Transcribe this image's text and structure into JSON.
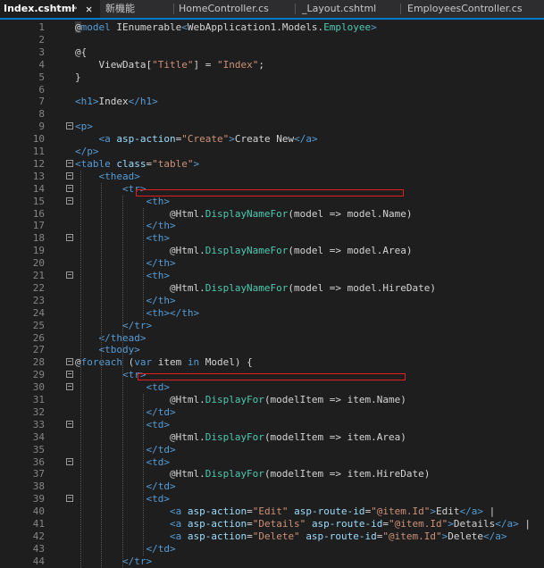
{
  "tabs": [
    {
      "label": "Index.cshtml",
      "active": true
    },
    {
      "label": "新機能",
      "active": false
    },
    {
      "label": "HomeController.cs",
      "active": false
    },
    {
      "label": "_Layout.cshtml",
      "active": false
    },
    {
      "label": "EmployeesController.cs",
      "active": false
    }
  ],
  "tab_icons": {
    "pin": "pin-icon",
    "close": "close-icon"
  },
  "tab_glyphs": {
    "pin": "⊸",
    "close": "✕"
  },
  "colors": {
    "background": "#1e1e1e",
    "tag": "#569cd6",
    "attribute": "#9cdcfe",
    "string": "#ce9178",
    "type": "#4ec9b0",
    "text": "#d4d4d4",
    "line_number": "#858585",
    "highlight_box": "#e02020"
  },
  "lines": [
    {
      "n": "1",
      "tokens": [
        [
          "at",
          "@"
        ],
        [
          "kw",
          "model "
        ],
        [
          "text",
          "IEnumerable"
        ],
        [
          "tag",
          "<"
        ],
        [
          "text",
          "WebApplication1.Models."
        ],
        [
          "type",
          "Employee"
        ],
        [
          "tag",
          ">"
        ]
      ]
    },
    {
      "n": "2",
      "tokens": []
    },
    {
      "n": "3",
      "tokens": [
        [
          "text",
          "@{"
        ]
      ]
    },
    {
      "n": "4",
      "tokens": [
        [
          "text",
          "    ViewData["
        ],
        [
          "str",
          "\"Title\""
        ],
        [
          "text",
          "] = "
        ],
        [
          "str",
          "\"Index\""
        ],
        [
          "text",
          ";"
        ]
      ]
    },
    {
      "n": "5",
      "tokens": [
        [
          "text",
          "}"
        ]
      ]
    },
    {
      "n": "6",
      "tokens": []
    },
    {
      "n": "7",
      "tokens": [
        [
          "tag",
          "<h1>"
        ],
        [
          "text",
          "Index"
        ],
        [
          "tag",
          "</h1>"
        ]
      ]
    },
    {
      "n": "8",
      "tokens": []
    },
    {
      "n": "9",
      "tokens": [
        [
          "tag",
          "<p>"
        ]
      ]
    },
    {
      "n": "10",
      "tokens": [
        [
          "text",
          "    "
        ],
        [
          "tag",
          "<a "
        ],
        [
          "attr",
          "asp-action"
        ],
        [
          "text",
          "="
        ],
        [
          "str",
          "\"Create\""
        ],
        [
          "tag",
          ">"
        ],
        [
          "text",
          "Create New"
        ],
        [
          "tag",
          "</a>"
        ]
      ]
    },
    {
      "n": "11",
      "tokens": [
        [
          "tag",
          "</p>"
        ]
      ]
    },
    {
      "n": "12",
      "tokens": [
        [
          "tag",
          "<table "
        ],
        [
          "attr",
          "class"
        ],
        [
          "text",
          "="
        ],
        [
          "str",
          "\"table\""
        ],
        [
          "tag",
          ">"
        ]
      ]
    },
    {
      "n": "13",
      "tokens": [
        [
          "text",
          "    "
        ],
        [
          "tag",
          "<thead>"
        ]
      ]
    },
    {
      "n": "14",
      "tokens": [
        [
          "text",
          "        "
        ],
        [
          "tag",
          "<tr>"
        ]
      ]
    },
    {
      "n": "15",
      "tokens": [
        [
          "text",
          "            "
        ],
        [
          "tag",
          "<th>"
        ]
      ]
    },
    {
      "n": "16",
      "tokens": [
        [
          "text",
          "                @Html."
        ],
        [
          "type",
          "DisplayNameFor"
        ],
        [
          "text",
          "(model => model.Name)"
        ]
      ]
    },
    {
      "n": "17",
      "tokens": [
        [
          "text",
          "            "
        ],
        [
          "tag",
          "</th>"
        ]
      ]
    },
    {
      "n": "18",
      "tokens": [
        [
          "text",
          "            "
        ],
        [
          "tag",
          "<th>"
        ]
      ]
    },
    {
      "n": "19",
      "tokens": [
        [
          "text",
          "                @Html."
        ],
        [
          "type",
          "DisplayNameFor"
        ],
        [
          "text",
          "(model => model.Area)"
        ]
      ]
    },
    {
      "n": "20",
      "tokens": [
        [
          "text",
          "            "
        ],
        [
          "tag",
          "</th>"
        ]
      ]
    },
    {
      "n": "21",
      "tokens": [
        [
          "text",
          "            "
        ],
        [
          "tag",
          "<th>"
        ]
      ]
    },
    {
      "n": "22",
      "tokens": [
        [
          "text",
          "                @Html."
        ],
        [
          "type",
          "DisplayNameFor"
        ],
        [
          "text",
          "(model => model.HireDate)"
        ]
      ]
    },
    {
      "n": "23",
      "tokens": [
        [
          "text",
          "            "
        ],
        [
          "tag",
          "</th>"
        ]
      ]
    },
    {
      "n": "24",
      "tokens": [
        [
          "text",
          "            "
        ],
        [
          "tag",
          "<th></th>"
        ]
      ]
    },
    {
      "n": "25",
      "tokens": [
        [
          "text",
          "        "
        ],
        [
          "tag",
          "</tr>"
        ]
      ]
    },
    {
      "n": "26",
      "tokens": [
        [
          "text",
          "    "
        ],
        [
          "tag",
          "</thead>"
        ]
      ]
    },
    {
      "n": "27",
      "tokens": [
        [
          "text",
          "    "
        ],
        [
          "tag",
          "<tbody>"
        ]
      ]
    },
    {
      "n": "28",
      "tokens": [
        [
          "text",
          "@"
        ],
        [
          "kw",
          "foreach"
        ],
        [
          "text",
          " ("
        ],
        [
          "kw",
          "var"
        ],
        [
          "text",
          " item "
        ],
        [
          "kw",
          "in"
        ],
        [
          "text",
          " Model) {"
        ]
      ]
    },
    {
      "n": "29",
      "tokens": [
        [
          "text",
          "        "
        ],
        [
          "tag",
          "<tr>"
        ]
      ]
    },
    {
      "n": "30",
      "tokens": [
        [
          "text",
          "            "
        ],
        [
          "tag",
          "<td>"
        ]
      ]
    },
    {
      "n": "31",
      "tokens": [
        [
          "text",
          "                @Html."
        ],
        [
          "type",
          "DisplayFor"
        ],
        [
          "text",
          "(modelItem => item.Name)"
        ]
      ]
    },
    {
      "n": "32",
      "tokens": [
        [
          "text",
          "            "
        ],
        [
          "tag",
          "</td>"
        ]
      ]
    },
    {
      "n": "33",
      "tokens": [
        [
          "text",
          "            "
        ],
        [
          "tag",
          "<td>"
        ]
      ]
    },
    {
      "n": "34",
      "tokens": [
        [
          "text",
          "                @Html."
        ],
        [
          "type",
          "DisplayFor"
        ],
        [
          "text",
          "(modelItem => item.Area)"
        ]
      ]
    },
    {
      "n": "35",
      "tokens": [
        [
          "text",
          "            "
        ],
        [
          "tag",
          "</td>"
        ]
      ]
    },
    {
      "n": "36",
      "tokens": [
        [
          "text",
          "            "
        ],
        [
          "tag",
          "<td>"
        ]
      ]
    },
    {
      "n": "37",
      "tokens": [
        [
          "text",
          "                @Html."
        ],
        [
          "type",
          "DisplayFor"
        ],
        [
          "text",
          "(modelItem => item.HireDate)"
        ]
      ]
    },
    {
      "n": "38",
      "tokens": [
        [
          "text",
          "            "
        ],
        [
          "tag",
          "</td>"
        ]
      ]
    },
    {
      "n": "39",
      "tokens": [
        [
          "text",
          "            "
        ],
        [
          "tag",
          "<td>"
        ]
      ]
    },
    {
      "n": "40",
      "tokens": [
        [
          "text",
          "                "
        ],
        [
          "tag",
          "<a "
        ],
        [
          "attr",
          "asp-action"
        ],
        [
          "text",
          "="
        ],
        [
          "str",
          "\"Edit\""
        ],
        [
          "text",
          " "
        ],
        [
          "attr",
          "asp-route-id"
        ],
        [
          "text",
          "="
        ],
        [
          "str",
          "\"@item.Id\""
        ],
        [
          "tag",
          ">"
        ],
        [
          "text",
          "Edit"
        ],
        [
          "tag",
          "</a>"
        ],
        [
          "text",
          " |"
        ]
      ]
    },
    {
      "n": "41",
      "tokens": [
        [
          "text",
          "                "
        ],
        [
          "tag",
          "<a "
        ],
        [
          "attr",
          "asp-action"
        ],
        [
          "text",
          "="
        ],
        [
          "str",
          "\"Details\""
        ],
        [
          "text",
          " "
        ],
        [
          "attr",
          "asp-route-id"
        ],
        [
          "text",
          "="
        ],
        [
          "str",
          "\"@item.Id\""
        ],
        [
          "tag",
          ">"
        ],
        [
          "text",
          "Details"
        ],
        [
          "tag",
          "</a>"
        ],
        [
          "text",
          " |"
        ]
      ]
    },
    {
      "n": "42",
      "tokens": [
        [
          "text",
          "                "
        ],
        [
          "tag",
          "<a "
        ],
        [
          "attr",
          "asp-action"
        ],
        [
          "text",
          "="
        ],
        [
          "str",
          "\"Delete\""
        ],
        [
          "text",
          " "
        ],
        [
          "attr",
          "asp-route-id"
        ],
        [
          "text",
          "="
        ],
        [
          "str",
          "\"@item.Id\""
        ],
        [
          "tag",
          ">"
        ],
        [
          "text",
          "Delete"
        ],
        [
          "tag",
          "</a>"
        ]
      ]
    },
    {
      "n": "43",
      "tokens": [
        [
          "text",
          "            "
        ],
        [
          "tag",
          "</td>"
        ]
      ]
    },
    {
      "n": "44",
      "tokens": [
        [
          "text",
          "        "
        ],
        [
          "tag",
          "</tr>"
        ]
      ]
    }
  ],
  "fold_lines": [
    "9",
    "12",
    "13",
    "14",
    "15",
    "18",
    "21",
    "28",
    "29",
    "30",
    "33",
    "36",
    "39"
  ]
}
